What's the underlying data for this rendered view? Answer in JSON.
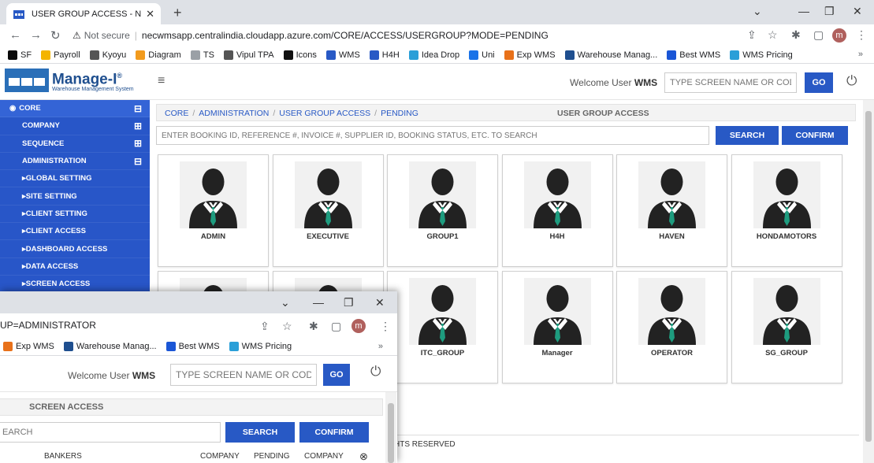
{
  "browser": {
    "tab_title": "USER GROUP ACCESS - NEC_WM",
    "url_warning": "Not secure",
    "url": "necwmsapp.centralindia.cloudapp.azure.com/CORE/ACCESS/USERGROUP?MODE=PENDING",
    "profile_initial": "m"
  },
  "bookmarks": [
    {
      "label": "SF",
      "icon": "sf-icon",
      "color": "#0a0a0a"
    },
    {
      "label": "Payroll",
      "icon": "payroll-icon",
      "color": "#f4b400"
    },
    {
      "label": "Kyoyu",
      "icon": "globe-icon",
      "color": "#555555"
    },
    {
      "label": "Diagram",
      "icon": "diagram-icon",
      "color": "#f29b1d"
    },
    {
      "label": "TS",
      "icon": "doc-icon",
      "color": "#9aa0a6"
    },
    {
      "label": "Vipul TPA",
      "icon": "globe-icon",
      "color": "#555555"
    },
    {
      "label": "Icons",
      "icon": "icons-icon",
      "color": "#111111"
    },
    {
      "label": "WMS",
      "icon": "wms-icon",
      "color": "#2859c5"
    },
    {
      "label": "H4H",
      "icon": "wms-icon",
      "color": "#2859c5"
    },
    {
      "label": "Idea Drop",
      "icon": "drop-icon",
      "color": "#2a9fd8"
    },
    {
      "label": "Uni",
      "icon": "uni-icon",
      "color": "#1a73e8"
    },
    {
      "label": "Exp WMS",
      "icon": "exp-icon",
      "color": "#e8711a"
    },
    {
      "label": "Warehouse Manag...",
      "icon": "warehouse-icon",
      "color": "#1f4f8f"
    },
    {
      "label": "Best WMS",
      "icon": "s-icon",
      "color": "#1a56d6"
    },
    {
      "label": "WMS Pricing",
      "icon": "pricing-icon",
      "color": "#2a9fd8"
    }
  ],
  "bookmarks_more": "»",
  "app": {
    "logo_title": "Manage-I",
    "logo_reg": "®",
    "logo_subtitle": "Warehouse Management System",
    "welcome_prefix": "Welcome User",
    "welcome_user": "WMS",
    "screen_placeholder": "TYPE SCREEN NAME OR CODE",
    "go_label": "GO"
  },
  "sidebar": {
    "items": [
      {
        "label": "CORE",
        "toggle": "⊟",
        "level": "top"
      },
      {
        "label": "COMPANY",
        "toggle": "⊞",
        "level": "child"
      },
      {
        "label": "SEQUENCE",
        "toggle": "⊞",
        "level": "child"
      },
      {
        "label": "ADMINISTRATION",
        "toggle": "⊟",
        "level": "child"
      },
      {
        "label": "▸GLOBAL SETTING",
        "toggle": "",
        "level": "sub"
      },
      {
        "label": "▸SITE SETTING",
        "toggle": "",
        "level": "sub"
      },
      {
        "label": "▸CLIENT SETTING",
        "toggle": "",
        "level": "sub"
      },
      {
        "label": "▸CLIENT ACCESS",
        "toggle": "",
        "level": "sub"
      },
      {
        "label": "▸DASHBOARD ACCESS",
        "toggle": "",
        "level": "sub"
      },
      {
        "label": "▸DATA ACCESS",
        "toggle": "",
        "level": "sub"
      },
      {
        "label": "▸SCREEN ACCESS",
        "toggle": "",
        "level": "sub"
      }
    ]
  },
  "breadcrumb": {
    "items": [
      "CORE",
      "ADMINISTRATION",
      "USER GROUP ACCESS",
      "PENDING"
    ],
    "page_title": "USER GROUP ACCESS"
  },
  "search": {
    "placeholder": "ENTER BOOKING ID, REFERENCE #, INVOICE #, SUPPLIER ID, BOOKING STATUS, ETC. TO SEARCH",
    "search_label": "SEARCH",
    "confirm_label": "CONFIRM"
  },
  "groups": [
    "ADMIN",
    "EXECUTIVE",
    "GROUP1",
    "H4H",
    "HAVEN",
    "HONDAMOTORS",
    "",
    "",
    "ITC_GROUP",
    "Manager",
    "OPERATOR",
    "SG_GROUP"
  ],
  "footer": "HTS RESERVED",
  "overlay": {
    "url_tail": "UP=ADMINISTRATOR",
    "bookmarks": [
      {
        "label": "Exp WMS",
        "icon": "exp-icon",
        "color": "#e8711a"
      },
      {
        "label": "Warehouse Manag...",
        "icon": "warehouse-icon",
        "color": "#1f4f8f"
      },
      {
        "label": "Best WMS",
        "icon": "s-icon",
        "color": "#1a56d6"
      },
      {
        "label": "WMS Pricing",
        "icon": "pricing-icon",
        "color": "#2a9fd8"
      }
    ],
    "bookmarks_more": "»",
    "welcome_prefix": "Welcome User",
    "welcome_user": "WMS",
    "screen_placeholder": "TYPE SCREEN NAME OR CODE",
    "go_label": "GO",
    "page_title": "SCREEN ACCESS",
    "search_placeholder": "EARCH",
    "search_label": "SEARCH",
    "confirm_label": "CONFIRM",
    "table_headers": [
      "BANKERS",
      "COMPANY",
      "PENDING",
      "COMPANY"
    ]
  },
  "colors": {
    "brand_blue": "#2859c5",
    "sidebar_blue": "#2856c8",
    "tie_green": "#1e9c7f"
  }
}
